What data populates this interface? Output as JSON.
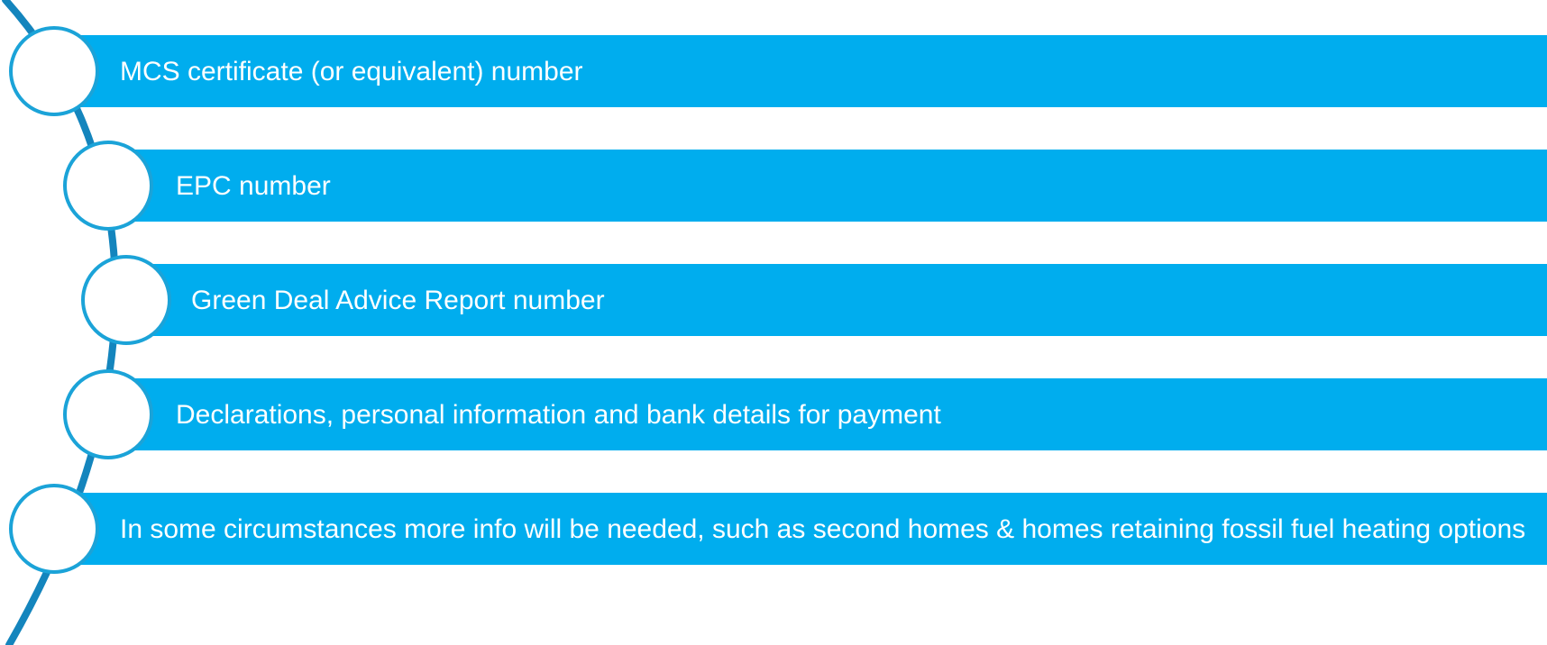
{
  "diagram": {
    "colors": {
      "bar_fill": "#00adee",
      "arc_stroke": "#1485bd",
      "node_border": "#1ba3d8",
      "node_fill": "#ffffff",
      "text": "#ffffff"
    },
    "items": [
      {
        "label": "MCS certificate (or equivalent) number"
      },
      {
        "label": "EPC number"
      },
      {
        "label": "Green Deal Advice Report number"
      },
      {
        "label": "Declarations, personal information and bank details for payment"
      },
      {
        "label": "In some circumstances more info will be needed, such as second homes & homes retaining fossil fuel heating options"
      }
    ]
  }
}
